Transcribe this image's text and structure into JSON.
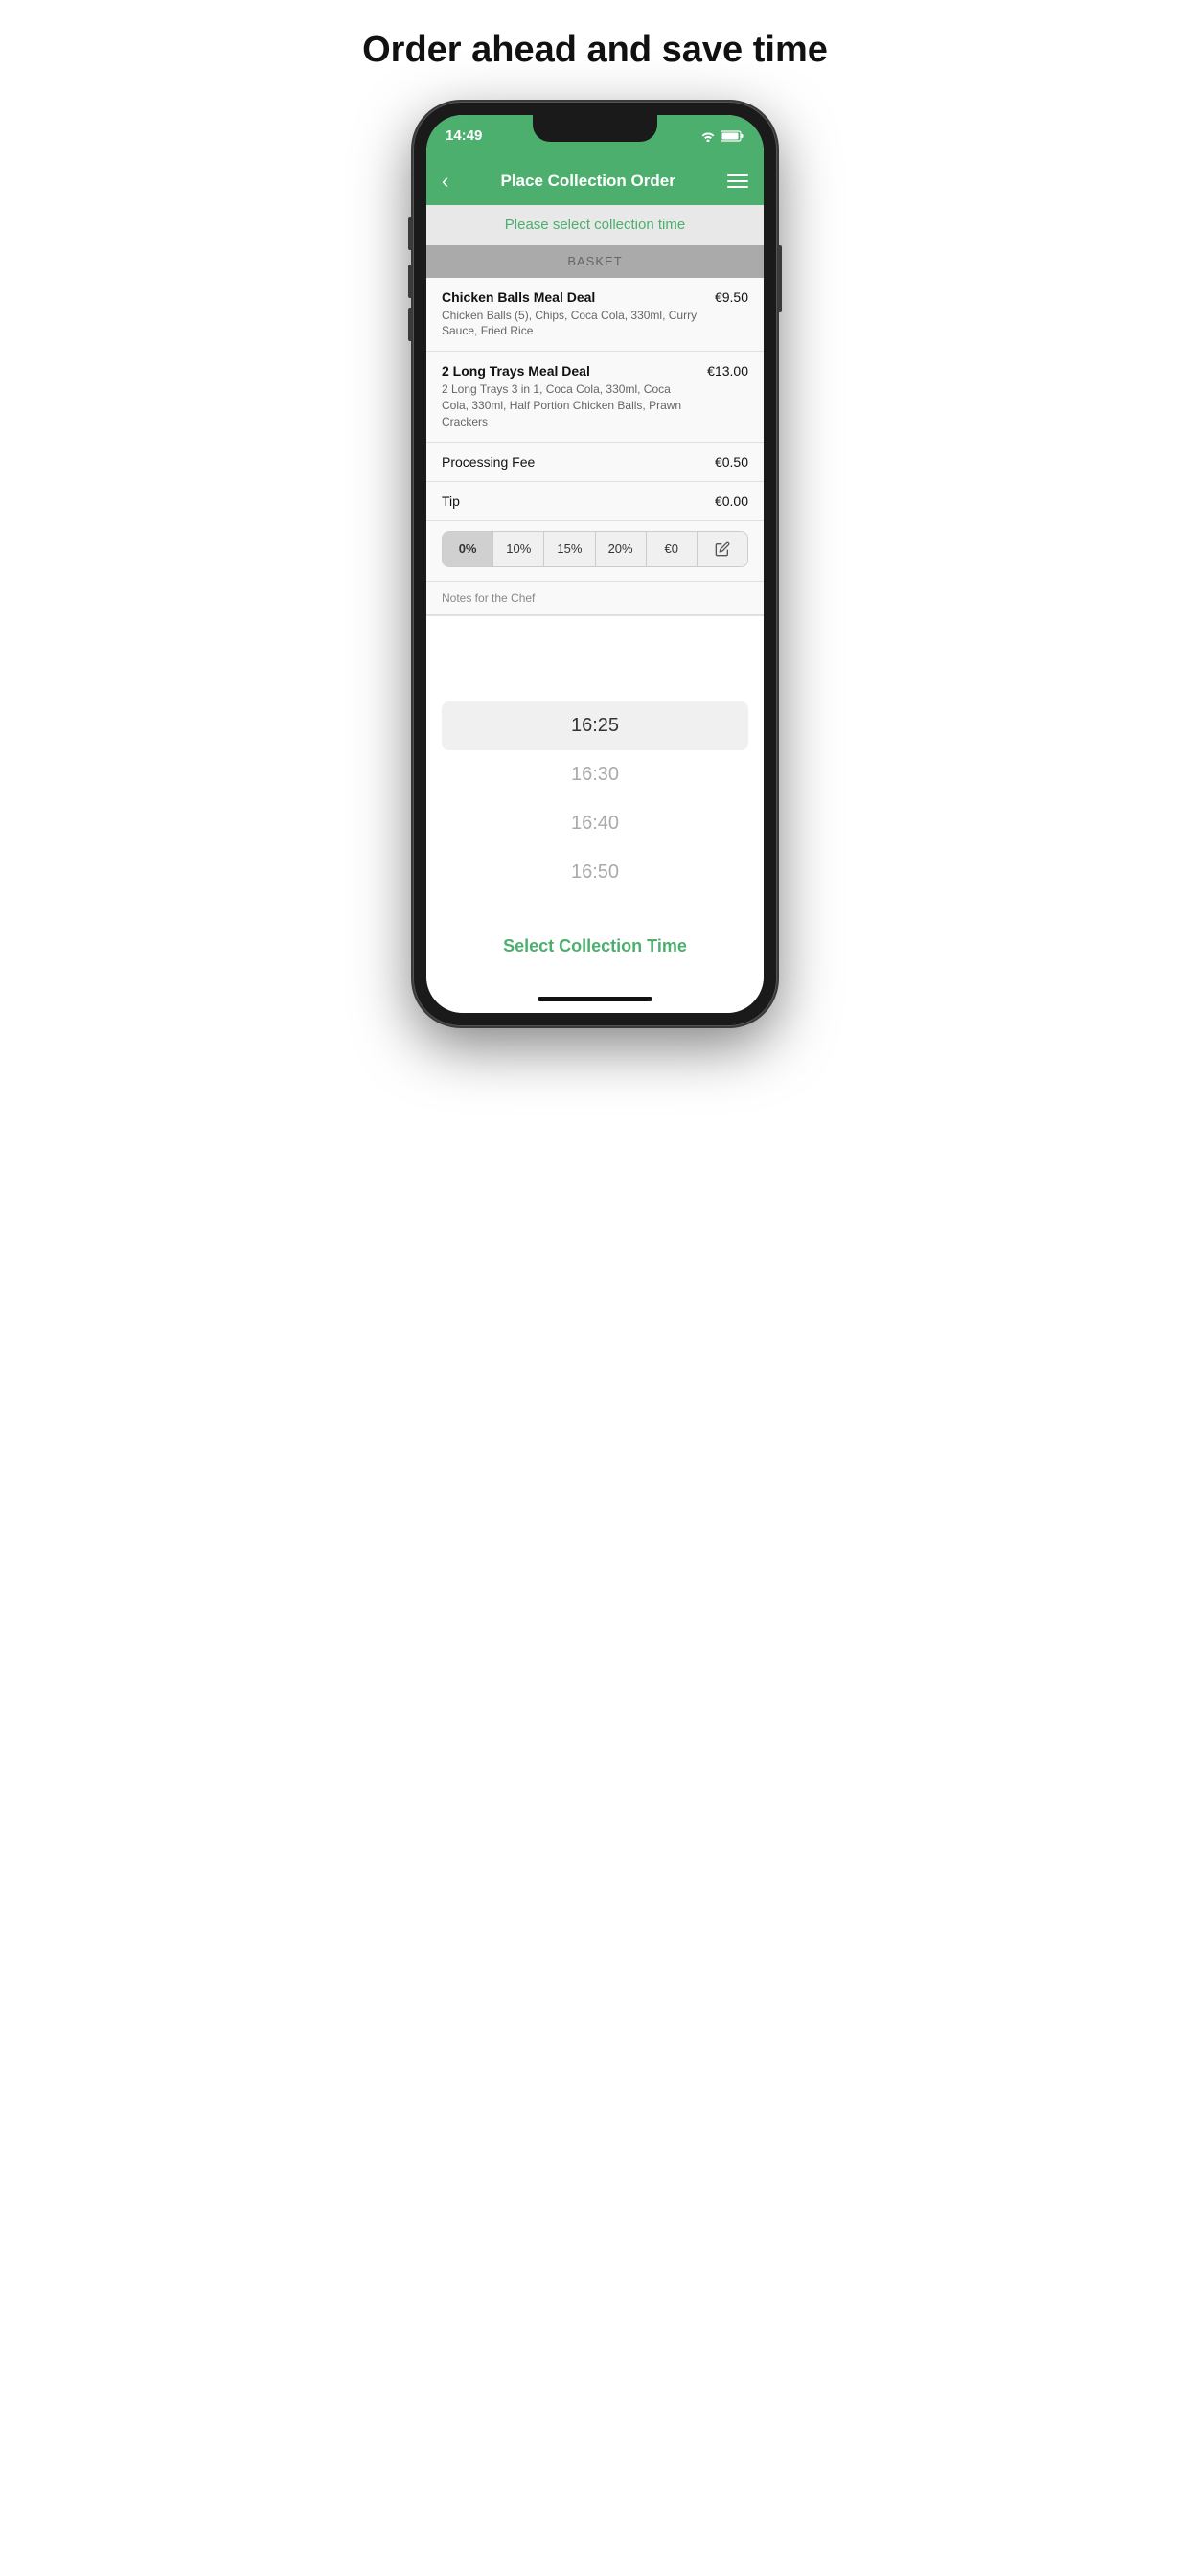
{
  "page": {
    "headline": "Order ahead and save time"
  },
  "status_bar": {
    "time": "14:49"
  },
  "nav": {
    "title": "Place Collection Order",
    "back_label": "‹",
    "menu_label": "menu"
  },
  "collection_banner": {
    "text": "Please select collection time"
  },
  "basket": {
    "header": "BASKET",
    "items": [
      {
        "name": "Chicken Balls Meal Deal",
        "description": "Chicken Balls (5), Chips, Coca Cola, 330ml, Curry Sauce, Fried Rice",
        "price": "€9.50"
      },
      {
        "name": "2 Long Trays Meal Deal",
        "description": "2 Long Trays 3 in 1, Coca Cola, 330ml, Coca Cola, 330ml, Half Portion Chicken Balls, Prawn Crackers",
        "price": "€13.00"
      }
    ],
    "processing_fee_label": "Processing Fee",
    "processing_fee_amount": "€0.50",
    "tip_label": "Tip",
    "tip_amount": "€0.00"
  },
  "tip_buttons": [
    {
      "label": "0%",
      "active": true
    },
    {
      "label": "10%",
      "active": false
    },
    {
      "label": "15%",
      "active": false
    },
    {
      "label": "20%",
      "active": false
    },
    {
      "label": "€0",
      "active": false
    },
    {
      "label": "✏",
      "active": false
    }
  ],
  "notes": {
    "label": "Notes for the Chef"
  },
  "time_picker": {
    "options": [
      {
        "time": "16:25",
        "selected": true
      },
      {
        "time": "16:30",
        "selected": false
      },
      {
        "time": "16:40",
        "selected": false
      },
      {
        "time": "16:50",
        "selected": false
      }
    ]
  },
  "select_button": {
    "label": "Select Collection Time"
  }
}
